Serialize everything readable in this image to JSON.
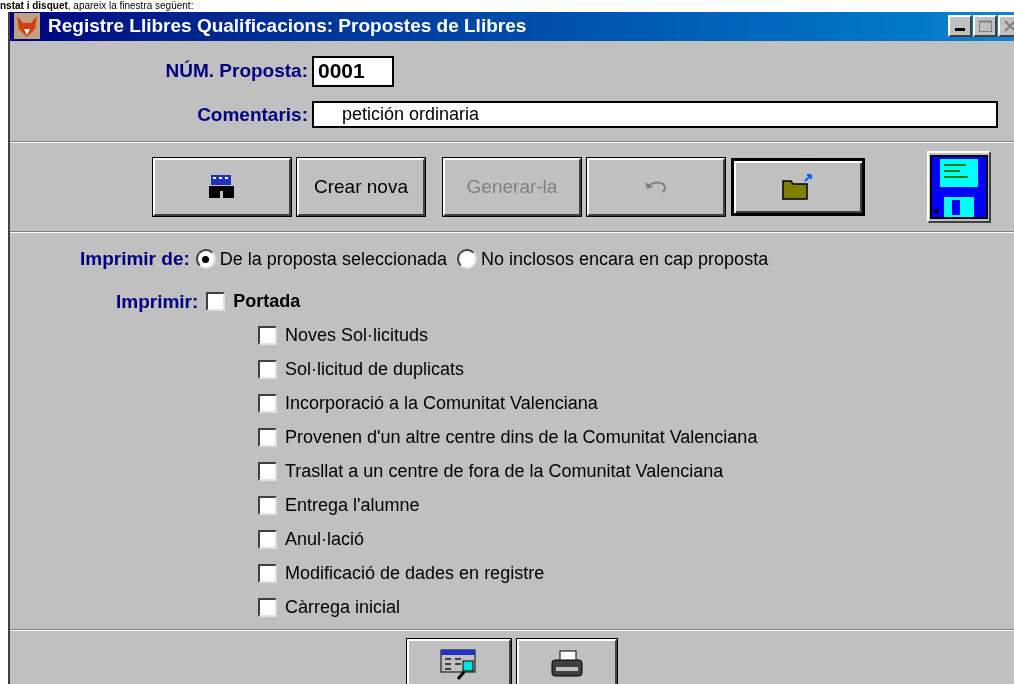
{
  "document_text": "**nstat i disquet**, apareix la finestra següent:",
  "window": {
    "title": "Registre Llibres Qualificacions: Propostes de Llibres"
  },
  "proposal_number": {
    "label": "NÚM. Proposta:",
    "value": "0001"
  },
  "comment": {
    "label": "Comentaris:",
    "value": "    petición ordinaria"
  },
  "toolbar": [
    {
      "kind": "icon",
      "disabled": false,
      "default": false
    },
    {
      "kind": "text",
      "label": "Crear nova",
      "disabled": false,
      "default": false
    },
    {
      "kind": "text",
      "label": "Generar-la",
      "disabled": true,
      "default": false
    },
    {
      "kind": "icon",
      "disabled": true,
      "default": false
    },
    {
      "kind": "icon",
      "disabled": false,
      "default": true
    }
  ],
  "print_from": {
    "label": "Imprimir de:",
    "options": [
      {
        "label": "De la proposta seleccionada",
        "selected": true
      },
      {
        "label": "No inclosos encara en cap proposta",
        "selected": false
      }
    ]
  },
  "print": {
    "label": "Imprimir:",
    "cover": {
      "label": "Portada",
      "checked": false
    },
    "items": [
      {
        "label": "Noves Sol·licituds",
        "checked": false
      },
      {
        "label": "Sol·licitud de duplicats",
        "checked": false
      },
      {
        "label": "Incorporació a la Comunitat Valenciana",
        "checked": false
      },
      {
        "label": "Provenen d'un altre centre dins de la Comunitat Valenciana",
        "checked": false
      },
      {
        "label": "Trasllat a un centre de fora de la Comunitat Valenciana",
        "checked": false
      },
      {
        "label": "Entrega l'alumne",
        "checked": false
      },
      {
        "label": "Anul·lació",
        "checked": false
      },
      {
        "label": "Modificació de dades en registre",
        "checked": false
      },
      {
        "label": "Càrrega inicial",
        "checked": false
      }
    ]
  }
}
